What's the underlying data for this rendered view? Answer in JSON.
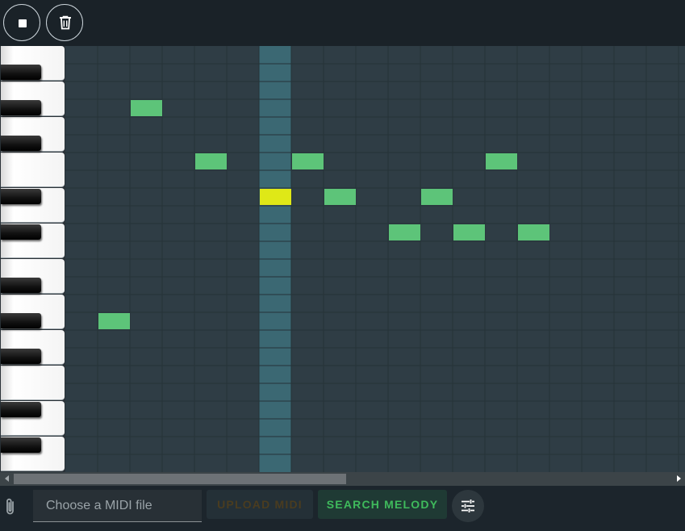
{
  "toolbar": {
    "stop_icon": "stop-icon",
    "clear_icon": "trash-icon"
  },
  "piano_roll": {
    "note_color": "#5dc479",
    "active_note_color": "#dfe817",
    "playhead_color": "#3b6873",
    "grid_bg": "#2f3d45",
    "rows": 24,
    "columns": 19,
    "playhead_column": 6,
    "notes": [
      {
        "col": 2,
        "row": 3,
        "active": false
      },
      {
        "col": 4,
        "row": 6,
        "active": false
      },
      {
        "col": 7,
        "row": 6,
        "active": false
      },
      {
        "col": 13,
        "row": 6,
        "active": false
      },
      {
        "col": 6,
        "row": 8,
        "active": true
      },
      {
        "col": 8,
        "row": 8,
        "active": false
      },
      {
        "col": 11,
        "row": 8,
        "active": false
      },
      {
        "col": 10,
        "row": 10,
        "active": false
      },
      {
        "col": 12,
        "row": 10,
        "active": false
      },
      {
        "col": 14,
        "row": 10,
        "active": false
      },
      {
        "col": 1,
        "row": 15,
        "active": false
      }
    ]
  },
  "bottom_bar": {
    "attach_icon": "paperclip-icon",
    "file_placeholder": "Choose a MIDI file",
    "upload_label": "UPLOAD MIDI",
    "search_label": "SEARCH MELODY",
    "settings_icon": "sliders-icon"
  }
}
